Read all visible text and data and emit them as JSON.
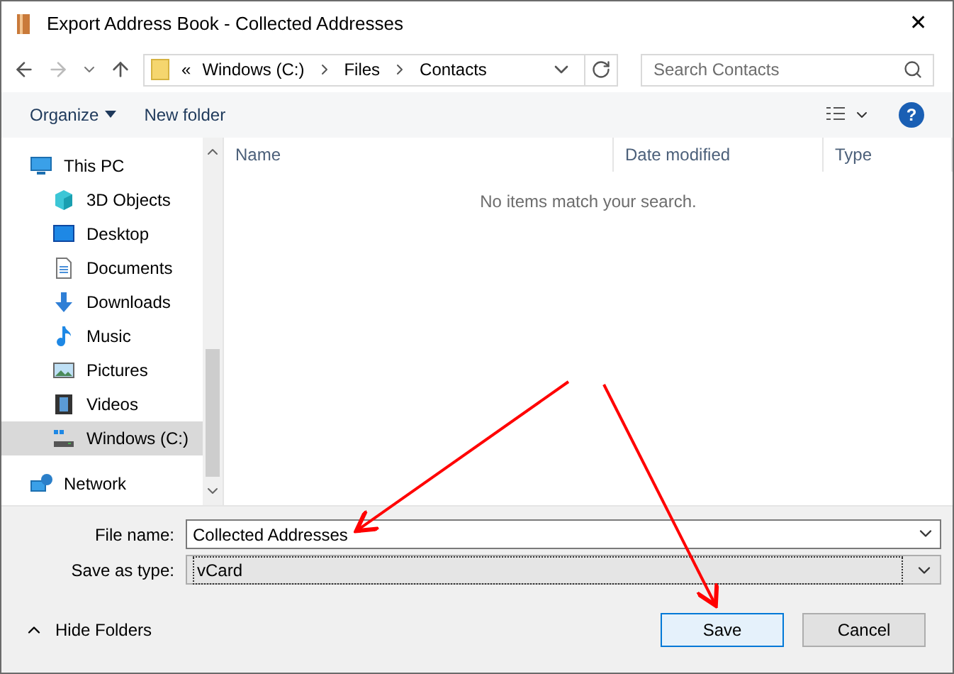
{
  "window": {
    "title": "Export Address Book - Collected Addresses",
    "close": "✕"
  },
  "address_bar": {
    "prefix": "«",
    "path": [
      {
        "label": "Windows (C:)"
      },
      {
        "label": "Files"
      },
      {
        "label": "Contacts"
      }
    ]
  },
  "search": {
    "placeholder": "Search Contacts"
  },
  "toolbar": {
    "organize": "Organize",
    "new_folder": "New folder",
    "help": "?"
  },
  "sidebar": {
    "items": [
      {
        "label": "This PC",
        "kind": "pc",
        "selected": false,
        "children": [
          {
            "label": "3D Objects",
            "kind": "cube",
            "selected": false
          },
          {
            "label": "Desktop",
            "kind": "desktop",
            "selected": false
          },
          {
            "label": "Documents",
            "kind": "doc",
            "selected": false
          },
          {
            "label": "Downloads",
            "kind": "download",
            "selected": false
          },
          {
            "label": "Music",
            "kind": "music",
            "selected": false
          },
          {
            "label": "Pictures",
            "kind": "picture",
            "selected": false
          },
          {
            "label": "Videos",
            "kind": "video",
            "selected": false
          },
          {
            "label": "Windows (C:)",
            "kind": "drive",
            "selected": true
          }
        ]
      },
      {
        "label": "Network",
        "kind": "network",
        "selected": false
      }
    ]
  },
  "table": {
    "columns": [
      "Name",
      "Date modified",
      "Type"
    ],
    "empty_message": "No items match your search."
  },
  "form": {
    "fields": [
      {
        "label": "File name:",
        "value": "Collected Addresses",
        "kind": "text"
      },
      {
        "label": "Save as type:",
        "value": "vCard",
        "kind": "select"
      }
    ]
  },
  "footer": {
    "hide_folders": "Hide Folders",
    "buttons": [
      {
        "label": "Save",
        "selected": true
      },
      {
        "label": "Cancel",
        "selected": false
      }
    ]
  }
}
